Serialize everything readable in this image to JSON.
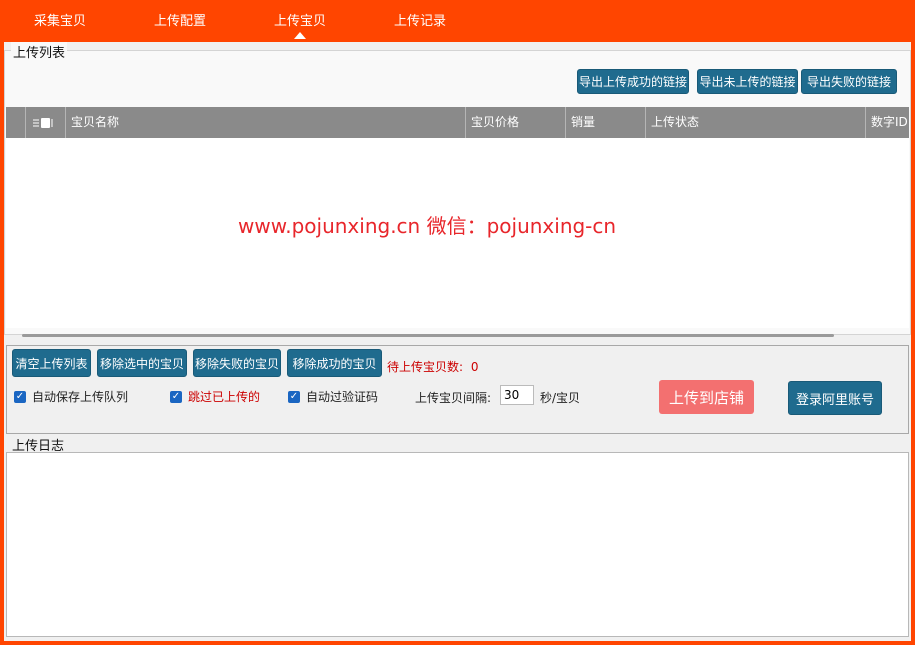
{
  "nav": {
    "tabs": [
      {
        "label": "采集宝贝"
      },
      {
        "label": "上传配置"
      },
      {
        "label": "上传宝贝"
      },
      {
        "label": "上传记录"
      }
    ],
    "active_tab": "上传宝贝"
  },
  "upload_list": {
    "title": "上传列表",
    "export_success_label": "导出上传成功的链接",
    "export_not_uploaded_label": "导出未上传的链接",
    "export_failed_label": "导出失败的链接",
    "columns": [
      "宝贝名称",
      "宝贝价格",
      "销量",
      "上传状态",
      "数字ID"
    ],
    "rows": [],
    "watermark": "www.pojunxing.cn  微信：pojunxing-cn"
  },
  "controls": {
    "clear_list_label": "清空上传列表",
    "remove_selected_label": "移除选中的宝贝",
    "remove_failed_label": "移除失败的宝贝",
    "remove_success_label": "移除成功的宝贝",
    "pending_label": "待上传宝贝数:",
    "pending_count": "0",
    "auto_save_label": "自动保存上传队列",
    "skip_uploaded_label": "跳过已上传的",
    "auto_captcha_label": "自动过验证码",
    "interval_label": "上传宝贝间隔:",
    "interval_value": "30",
    "interval_unit": "秒/宝贝",
    "upload_to_store_label": "上传到店铺",
    "login_label": "登录阿里账号"
  },
  "log": {
    "title": "上传日志",
    "content": ""
  },
  "colors": {
    "brand": "#ff4500",
    "button_dark": "#1f6b8e",
    "button_upload": "#f37070",
    "warning_text": "#cc0000",
    "checkbox": "#1a66c2"
  }
}
